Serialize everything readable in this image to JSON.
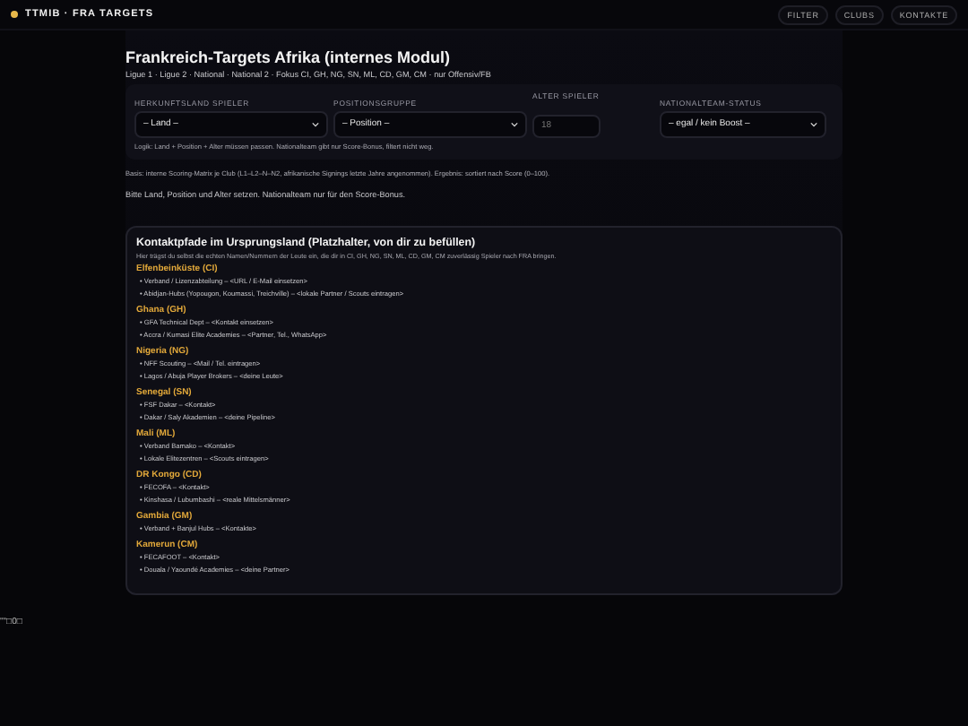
{
  "header": {
    "brand": "TTMIB · FRA TARGETS",
    "nav": [
      {
        "label": "FILTER"
      },
      {
        "label": "CLUBS"
      },
      {
        "label": "KONTAKTE"
      }
    ]
  },
  "page": {
    "title": "Frankreich-Targets Afrika (internes Modul)",
    "subtitle": "Ligue 1 · Ligue 2 · National · National 2 · Fokus CI, GH, NG, SN, ML, CD, GM, CM · nur Offensiv/FB"
  },
  "filters": {
    "fields": [
      {
        "kind": "select",
        "label": "HERKUNFTSLAND SPIELER",
        "value": "– Land –"
      },
      {
        "kind": "select",
        "label": "POSITIONSGRUPPE",
        "value": "– Position –"
      },
      {
        "kind": "number",
        "label": "ALTER SPIELER",
        "placeholder": "18"
      },
      {
        "kind": "select",
        "label": "NATIONALTEAM-STATUS",
        "value": "– egal / kein Boost –"
      }
    ],
    "hint": "Logik: Land + Position + Alter müssen passen. Nationalteam gibt nur Score-Bonus, filtert nicht weg."
  },
  "basis_note": "Basis: interne Scoring-Matrix je Club (L1–L2–N–N2, afrikanische Signings letzte Jahre angenommen). Ergebnis: sortiert nach Score (0–100).",
  "status_message": "Bitte Land, Position und Alter setzen. Nationalteam nur für den Score-Bonus.",
  "contacts": {
    "title": "Kontaktpfade im Ursprungsland (Platzhalter, von dir zu befüllen)",
    "intro": "Hier trägst du selbst die echten Namen/Nummern der Leute ein, die dir in CI, GH, NG, SN, ML, CD, GM, CM zuverlässig Spieler nach FRA bringen.",
    "countries": [
      {
        "name": "Elfenbeinküste (CI)",
        "items": [
          "• Verband / Lizenzabteilung – <URL / E-Mail einsetzen>",
          "• Abidjan-Hubs (Yopougon, Koumassi, Treichville) – <lokale Partner / Scouts eintragen>"
        ]
      },
      {
        "name": "Ghana (GH)",
        "items": [
          "• GFA Technical Dept – <Kontakt einsetzen>",
          "• Accra / Kumasi Elite Academies – <Partner, Tel., WhatsApp>"
        ]
      },
      {
        "name": "Nigeria (NG)",
        "items": [
          "• NFF Scouting – <Mail / Tel. eintragen>",
          "• Lagos / Abuja Player Brokers – <deine Leute>"
        ]
      },
      {
        "name": "Senegal (SN)",
        "items": [
          "• FSF Dakar – <Kontakt>",
          "• Dakar / Saly Akademien – <deine Pipeline>"
        ]
      },
      {
        "name": "Mali (ML)",
        "items": [
          "• Verband Bamako – <Kontakt>",
          "• Lokale Elitezentren – <Scouts eintragen>"
        ]
      },
      {
        "name": "DR Kongo (CD)",
        "items": [
          "• FECOFA – <Kontakt>",
          "• Kinshasa / Lubumbashi – <reale Mittelsmänner>"
        ]
      },
      {
        "name": "Gambia (GM)",
        "items": [
          "• Verband + Banjul Hubs – <Kontakte>"
        ]
      },
      {
        "name": "Kamerun (CM)",
        "items": [
          "• FECAFOOT – <Kontakt>",
          "• Douala / Yaoundé Academies – <deine Partner>"
        ]
      }
    ]
  },
  "footer_text": "\"\"□0□"
}
